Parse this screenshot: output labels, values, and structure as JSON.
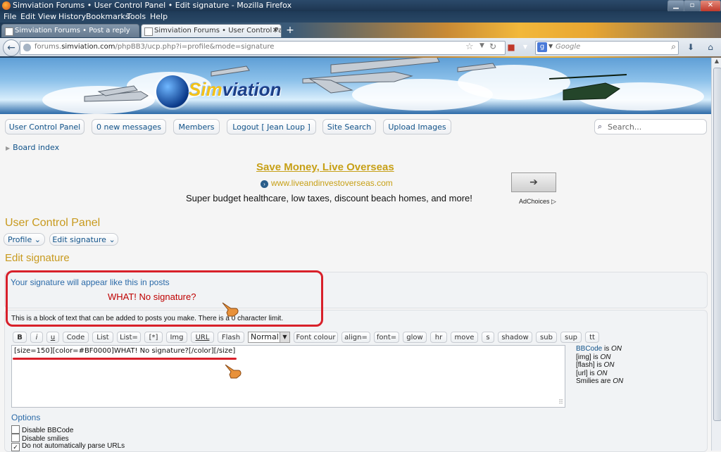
{
  "window": {
    "title": "Simviation Forums • User Control Panel • Edit signature - Mozilla Firefox"
  },
  "menu": [
    "File",
    "Edit",
    "View",
    "History",
    "Bookmarks",
    "Tools",
    "Help"
  ],
  "tabs": [
    {
      "label": "Simviation Forums • Post a reply"
    },
    {
      "label": "Simviation Forums • User Control Pa..."
    }
  ],
  "address": {
    "url_prefix": "forums.",
    "url_domain": "simviation.com",
    "url_rest": "/phpBB3/ucp.php?i=profile&mode=signature"
  },
  "browser_search": {
    "placeholder": "Google"
  },
  "site": {
    "logo_a": "Sim",
    "logo_b": "viation",
    "nav": [
      "User Control Panel",
      "0 new messages",
      "Members",
      "Logout [ Jean Loup ]",
      "Site Search",
      "Upload Images"
    ],
    "search_placeholder": "Search..."
  },
  "breadcrumb": "Board index",
  "ad": {
    "title": "Save Money, Live Overseas",
    "link": "www.liveandinvestoverseas.com",
    "desc": "Super budget healthcare, low taxes, discount beach homes, and more!",
    "choices": "AdChoices"
  },
  "ucp": {
    "title": "User Control Panel",
    "tabs": [
      "Profile",
      "Edit signature"
    ],
    "section_title": "Edit signature"
  },
  "signature": {
    "preview_label": "Your signature will appear like this in posts",
    "preview_text": "WHAT! No signature?",
    "preview_color": "#bf0000",
    "description": "This is a block of text that can be added to posts you make. There is a 0 character limit.",
    "toolbar": [
      "B",
      "i",
      "u",
      "Code",
      "List",
      "List=",
      "[*]",
      "Img",
      "URL",
      "Flash"
    ],
    "size_select": "Normal",
    "toolbar_right": [
      "Font colour",
      "align=",
      "font=",
      "glow",
      "hr",
      "move",
      "s",
      "shadow",
      "sub",
      "sup",
      "tt"
    ],
    "textarea_value": "[size=150][color=#BF0000]WHAT! No signature?[/color][/size]"
  },
  "bbinfo": {
    "line1_a": "BBCode",
    "line1_b": " is ",
    "line1_c": "ON",
    "line2_a": "[img]",
    "line2_b": " is ",
    "line2_c": "ON",
    "line3_a": "[flash]",
    "line3_b": " is ",
    "line3_c": "ON",
    "line4_a": "[url]",
    "line4_b": " is ",
    "line4_c": "ON",
    "line5_a": "Smilies",
    "line5_b": " are ",
    "line5_c": "ON"
  },
  "options": {
    "title": "Options",
    "items": [
      {
        "label": "Disable BBCode",
        "checked": false
      },
      {
        "label": "Disable smilies",
        "checked": false
      },
      {
        "label": "Do not automatically parse URLs",
        "checked": true
      }
    ]
  },
  "colors": {
    "accent_gold": "#c89a1e",
    "link_blue": "#105289",
    "annotation_red": "#d8202a"
  }
}
